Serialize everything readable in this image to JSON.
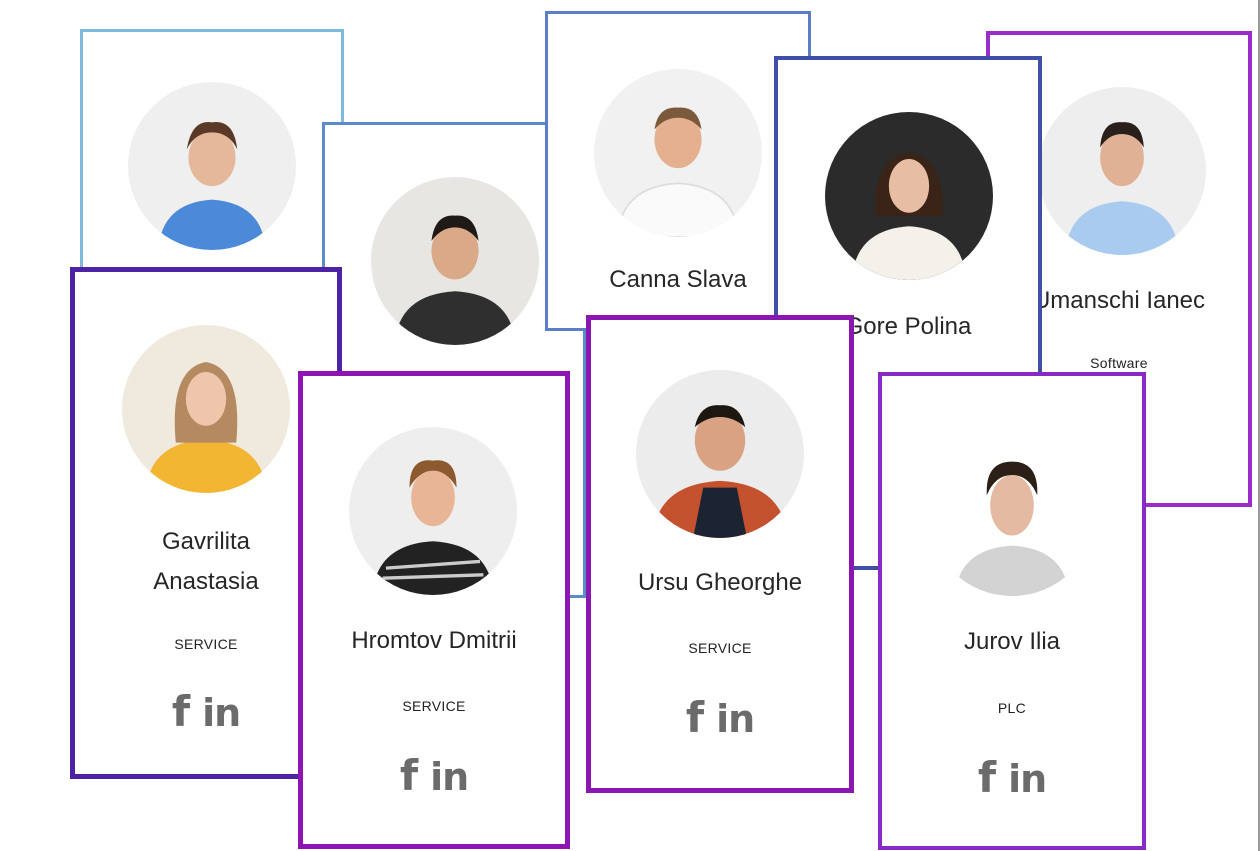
{
  "team": [
    {
      "name": "",
      "dept": "",
      "border": "#7fb8dc"
    },
    {
      "name": "",
      "dept": "",
      "border": "#5b8cc9"
    },
    {
      "name": "Canna Slava",
      "dept": "",
      "border": "#5b7ec6"
    },
    {
      "name": "Gore Polina",
      "dept": "",
      "border": "#3f4fa8"
    },
    {
      "name": "Umanschi Ianec",
      "dept": "Software",
      "border": "#9a2cc8"
    },
    {
      "name": "Gavrilita",
      "name2": "Anastasia",
      "dept": "SERVICE",
      "border": "#4b23a4"
    },
    {
      "name": "Hromtov Dmitrii",
      "dept": "SERVICE",
      "border": "#8e14b4"
    },
    {
      "name": "Ursu Gheorghe",
      "dept": "SERVICE",
      "border": "#8a18b0"
    },
    {
      "name": "Jurov Ilia",
      "dept": "PLC",
      "border": "#8a2ac4"
    }
  ],
  "icons": {
    "facebook": "f",
    "linkedin": "in"
  }
}
